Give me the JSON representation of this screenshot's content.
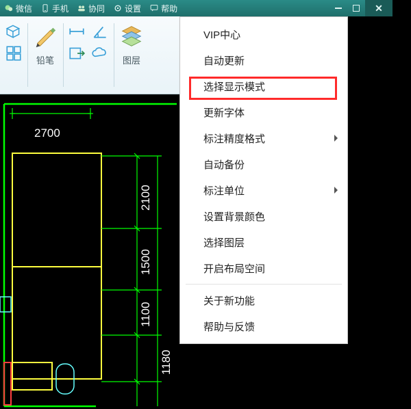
{
  "titlebar": {
    "items": [
      {
        "icon": "wechat-icon",
        "label": "微信"
      },
      {
        "icon": "mobile-icon",
        "label": "手机"
      },
      {
        "icon": "collab-icon",
        "label": "协同"
      },
      {
        "icon": "gear-icon",
        "label": "设置"
      },
      {
        "icon": "help-icon",
        "label": "帮助"
      }
    ]
  },
  "toolbar": {
    "group1_label": "",
    "pencil_label": "铅笔",
    "layers_label": "图层"
  },
  "dropdown": {
    "items": [
      {
        "label": "VIP中心",
        "has_submenu": false
      },
      {
        "label": "自动更新",
        "has_submenu": false
      },
      {
        "label": "选择显示模式",
        "has_submenu": false,
        "highlighted": true
      },
      {
        "label": "更新字体",
        "has_submenu": false
      },
      {
        "label": "标注精度格式",
        "has_submenu": true
      },
      {
        "label": "自动备份",
        "has_submenu": false
      },
      {
        "label": "标注单位",
        "has_submenu": true
      },
      {
        "label": "设置背景颜色",
        "has_submenu": false
      },
      {
        "label": "选择图层",
        "has_submenu": false
      },
      {
        "label": "开启布局空间",
        "has_submenu": false
      },
      {
        "label": "---"
      },
      {
        "label": "关于新功能",
        "has_submenu": false
      },
      {
        "label": "帮助与反馈",
        "has_submenu": false
      }
    ]
  },
  "cad": {
    "dimensions": {
      "top": "2700",
      "right_1": "2100",
      "right_2": "1500",
      "right_3": "1100",
      "right_4": "1180"
    },
    "colors": {
      "green": "#00ff00",
      "yellow": "#ffff3f",
      "cyan": "#66ffff",
      "red": "#ff3f3f"
    }
  }
}
